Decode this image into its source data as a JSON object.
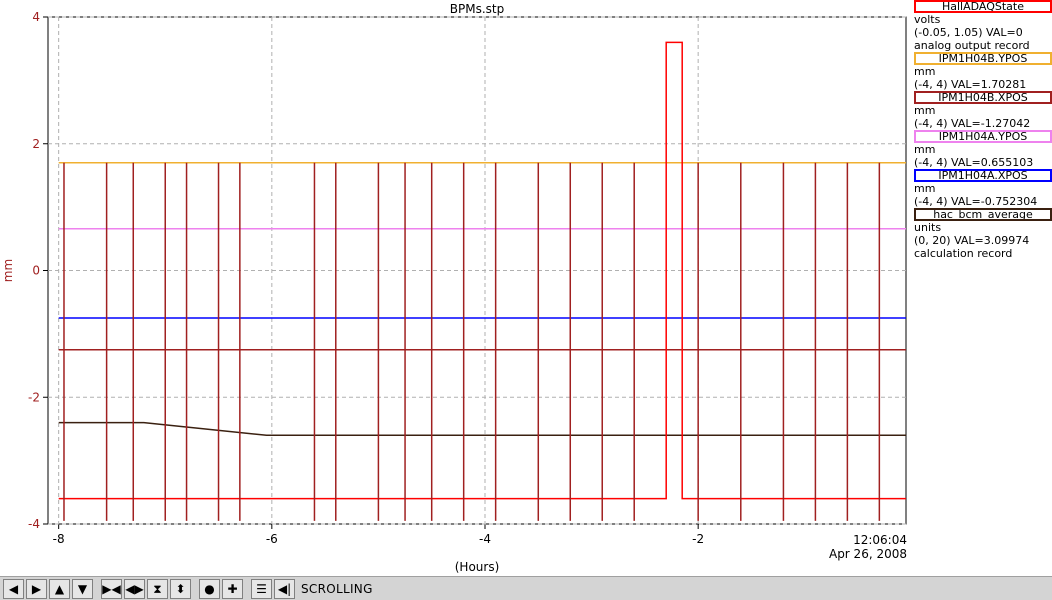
{
  "chart_data": {
    "type": "line",
    "title": "BPMs.stp",
    "xlabel": "(Hours)",
    "ylabel": "mm",
    "xlim": [
      -8.1,
      -0.05
    ],
    "ylim": [
      -4,
      4
    ],
    "x_ticks": [
      -8,
      -6,
      -4,
      -2
    ],
    "y_ticks": [
      4,
      2,
      0,
      -2,
      -4
    ],
    "grid": true,
    "time_label": "12:06:04",
    "date_label": "Apr 26, 2008",
    "legend_position": "right",
    "series": [
      {
        "name": "HallADAQState",
        "color": "#ff0000",
        "unit": "volts",
        "range": "(-0.05, 1.05)",
        "value": "VAL=0",
        "record": "analog output record",
        "x": [
          -8.0,
          -2.3,
          -2.3,
          -2.15,
          -2.15,
          -0.05
        ],
        "y": [
          -3.6,
          -3.6,
          3.6,
          3.6,
          -3.6,
          -3.6
        ]
      },
      {
        "name": "IPM1H04B.YPOS",
        "color": "#f0b030",
        "unit": "mm",
        "range": "(-4, 4)",
        "value": "VAL=1.70281",
        "x": [
          -8.0,
          -6.05,
          -5.85,
          -4.75,
          -0.05
        ],
        "y": [
          1.7,
          1.7,
          1.7,
          1.7,
          1.7
        ]
      },
      {
        "name": "IPM1H04B.XPOS",
        "color": "#a02020",
        "unit": "mm",
        "range": "(-4, 4)",
        "value": "VAL=-1.27042",
        "x": [
          -8.0,
          -6.05,
          -5.85,
          -4.75,
          -0.05
        ],
        "y": [
          -1.25,
          -1.25,
          -1.25,
          -1.25,
          -1.25
        ]
      },
      {
        "name": "IPM1H04A.YPOS",
        "color": "#ee82ee",
        "unit": "mm",
        "range": "(-4, 4)",
        "value": "VAL=0.655103",
        "x": [
          -8.0,
          -6.05,
          -5.85,
          -4.75,
          -0.05
        ],
        "y": [
          0.66,
          0.66,
          0.66,
          0.66,
          0.66
        ]
      },
      {
        "name": "IPM1H04A.XPOS",
        "color": "#0000ff",
        "unit": "mm",
        "range": "(-4, 4)",
        "value": "VAL=-0.752304",
        "x": [
          -8.0,
          -6.05,
          -5.85,
          -4.75,
          -0.05
        ],
        "y": [
          -0.75,
          -0.75,
          -0.75,
          -0.75,
          -0.75
        ]
      },
      {
        "name": "hac_bcm_average",
        "color": "#3a2010",
        "unit": "units",
        "range": "(0, 20)",
        "value": "VAL=3.09974",
        "record": "calculation record",
        "x": [
          -8.0,
          -7.2,
          -6.05,
          -5.85,
          -4.75,
          -0.05
        ],
        "y": [
          -2.4,
          -2.4,
          -2.6,
          -2.6,
          -2.6,
          -2.6
        ]
      }
    ]
  },
  "toolbar": {
    "buttons": [
      "arrow-left-icon",
      "arrow-right-icon",
      "arrow-up-icon",
      "arrow-down-icon",
      "zoom-in-horizontal-icon",
      "zoom-out-horizontal-icon",
      "zoom-in-vertical-icon",
      "zoom-out-vertical-icon",
      "record-icon",
      "crosshair-icon",
      "config-icon",
      "info-icon"
    ],
    "status": "SCROLLING"
  }
}
